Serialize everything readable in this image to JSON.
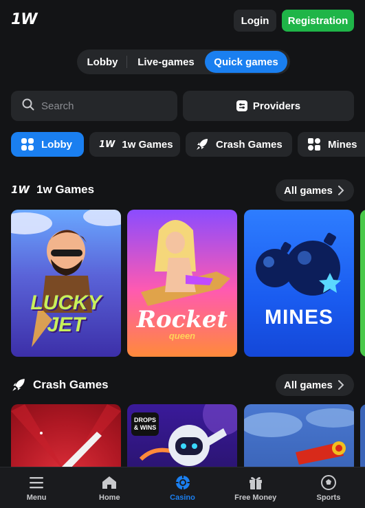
{
  "header": {
    "logo": "1W",
    "login_label": "Login",
    "registration_label": "Registration"
  },
  "segmented": {
    "lobby": "Lobby",
    "live": "Live-games",
    "quick": "Quick games"
  },
  "search": {
    "placeholder": "Search"
  },
  "providers_label": "Providers",
  "chips": {
    "lobby": "Lobby",
    "onew_icon": "1W",
    "onew": "1w Games",
    "crash": "Crash Games",
    "mines": "Mines"
  },
  "section_1w": {
    "logo": "1W",
    "title": "1w Games",
    "all_label": "All games"
  },
  "games_1w": {
    "lucky_jet": "LUCKY JET",
    "rocket": "Rocket",
    "rocket_sub": "queen",
    "mines": "MINES"
  },
  "section_crash": {
    "title": "Crash Games",
    "all_label": "All games"
  },
  "games_crash": {
    "drops_badge_1": "DROPS",
    "drops_badge_2": "& WINS"
  },
  "bottom_nav": {
    "menu": "Menu",
    "home": "Home",
    "casino": "Casino",
    "free_money": "Free Money",
    "sports": "Sports"
  },
  "colors": {
    "accent": "#1a7ff0",
    "registration": "#1fb548",
    "background": "#131416",
    "surface": "#25272a"
  }
}
